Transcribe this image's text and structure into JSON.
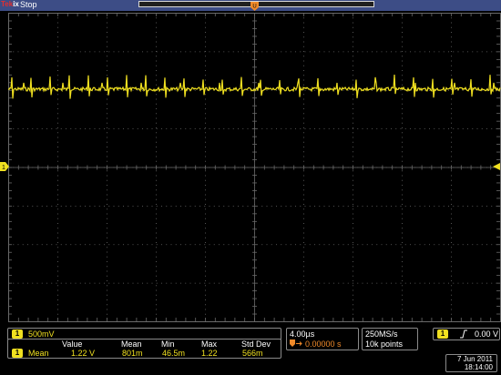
{
  "top": {
    "brand_tek": "Tek",
    "brand_ix": "ix",
    "status": "Stop"
  },
  "markers": {
    "trigger_position_label": "U",
    "channel_ground_label": "1"
  },
  "channel": {
    "number": "1",
    "scale": "500mV"
  },
  "measurement": {
    "headers": [
      "Value",
      "Mean",
      "Min",
      "Max",
      "Std Dev"
    ],
    "row_channel": "1",
    "row_label": "Mean",
    "values": [
      "1.22 V",
      "801m",
      "46.5m",
      "1.22",
      "566m"
    ]
  },
  "timebase": {
    "scale": "4.00µs",
    "delay_icon": "delay-icon",
    "position": "0.00000 s"
  },
  "acquisition": {
    "sample_rate": "250MS/s",
    "record_length": "10k points"
  },
  "trigger": {
    "channel": "1",
    "slope_icon": "rising-edge-icon",
    "level": "0.00 V"
  },
  "datetime": {
    "date": "7 Jun 2011",
    "time": "18:14:00"
  },
  "colors": {
    "channel1": "#f0e020",
    "topbar": "#3d4d86",
    "trigger": "#f08a2a",
    "graticule": "#6a6a6a"
  }
}
